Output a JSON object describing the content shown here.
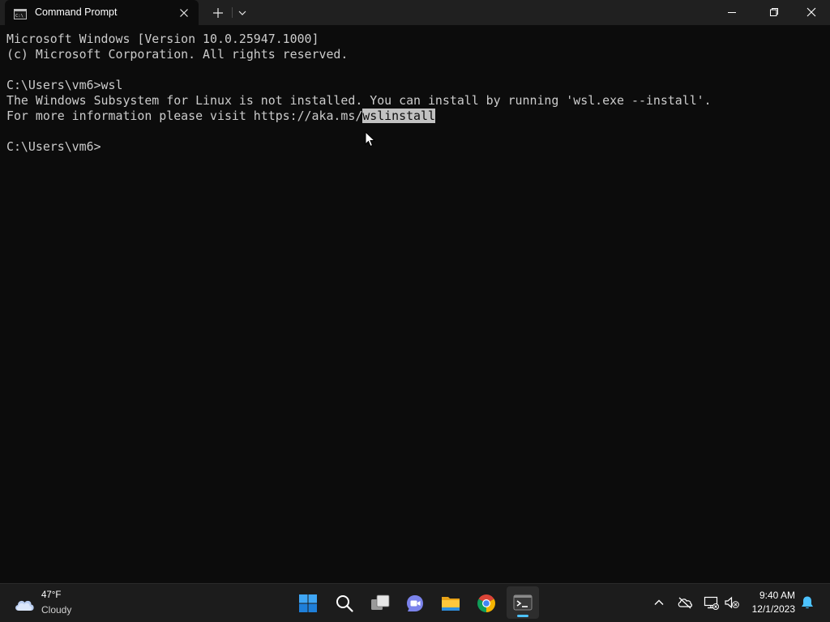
{
  "window": {
    "tab_title": "Command Prompt",
    "icons": {
      "tab": "command-prompt-icon",
      "close_tab": "close-icon",
      "new_tab": "plus-icon",
      "dropdown": "chevron-down-icon",
      "minimize": "minimize-icon",
      "maximize": "restore-icon",
      "close": "close-icon"
    }
  },
  "terminal": {
    "lines": [
      "Microsoft Windows [Version 10.0.25947.1000]",
      "(c) Microsoft Corporation. All rights reserved.",
      "",
      "C:\\Users\\vm6>wsl",
      "The Windows Subsystem for Linux is not installed. You can install by running 'wsl.exe --install'.",
      "For more information please visit https://aka.ms/",
      "",
      "C:\\Users\\vm6>"
    ],
    "selected_text": "wslinstall",
    "colors": {
      "background": "#0c0c0c",
      "text": "#cccccc",
      "selection": "#c2c2c2"
    }
  },
  "taskbar": {
    "weather": {
      "temperature": "47°F",
      "condition": "Cloudy",
      "icon": "cloud-icon"
    },
    "apps": [
      {
        "name": "start",
        "icon": "windows-logo-icon"
      },
      {
        "name": "search",
        "icon": "search-icon"
      },
      {
        "name": "task-view",
        "icon": "task-view-icon"
      },
      {
        "name": "teams-chat",
        "icon": "video-chat-icon"
      },
      {
        "name": "file-explorer",
        "icon": "folder-icon"
      },
      {
        "name": "chrome",
        "icon": "chrome-icon"
      },
      {
        "name": "terminal",
        "icon": "terminal-icon",
        "active": true
      }
    ],
    "tray": {
      "icons": [
        "chevron-up-icon",
        "cloud-offline-icon",
        "network-icon",
        "volume-muted-icon"
      ],
      "time": "9:40 AM",
      "date": "12/1/2023",
      "notification_icon": "bell-icon"
    },
    "accent": "#4cc2ff"
  }
}
